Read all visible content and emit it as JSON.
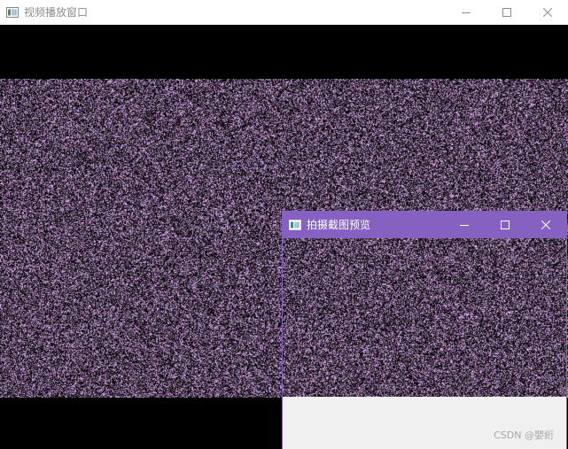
{
  "main_window": {
    "title": "视频播放窗口",
    "icon": "app-window-icon",
    "controls": [
      "minimize-icon",
      "maximize-icon",
      "close-icon"
    ]
  },
  "preview_window": {
    "title": "拍摄截图预览",
    "icon": "app-window-icon",
    "controls": [
      "minimize-icon",
      "maximize-icon",
      "close-icon"
    ],
    "accent_color": "#8661c1"
  },
  "watermark": "CSDN @嬰絎",
  "colors": {
    "video_background": "#000000",
    "titlebar_inactive": "#ffffff",
    "title_inactive_text": "#8c8c8c",
    "preview_titlebar": "#8661c1",
    "preview_client": "#f0f0f0",
    "noise_tint": "#8a7fa3"
  }
}
